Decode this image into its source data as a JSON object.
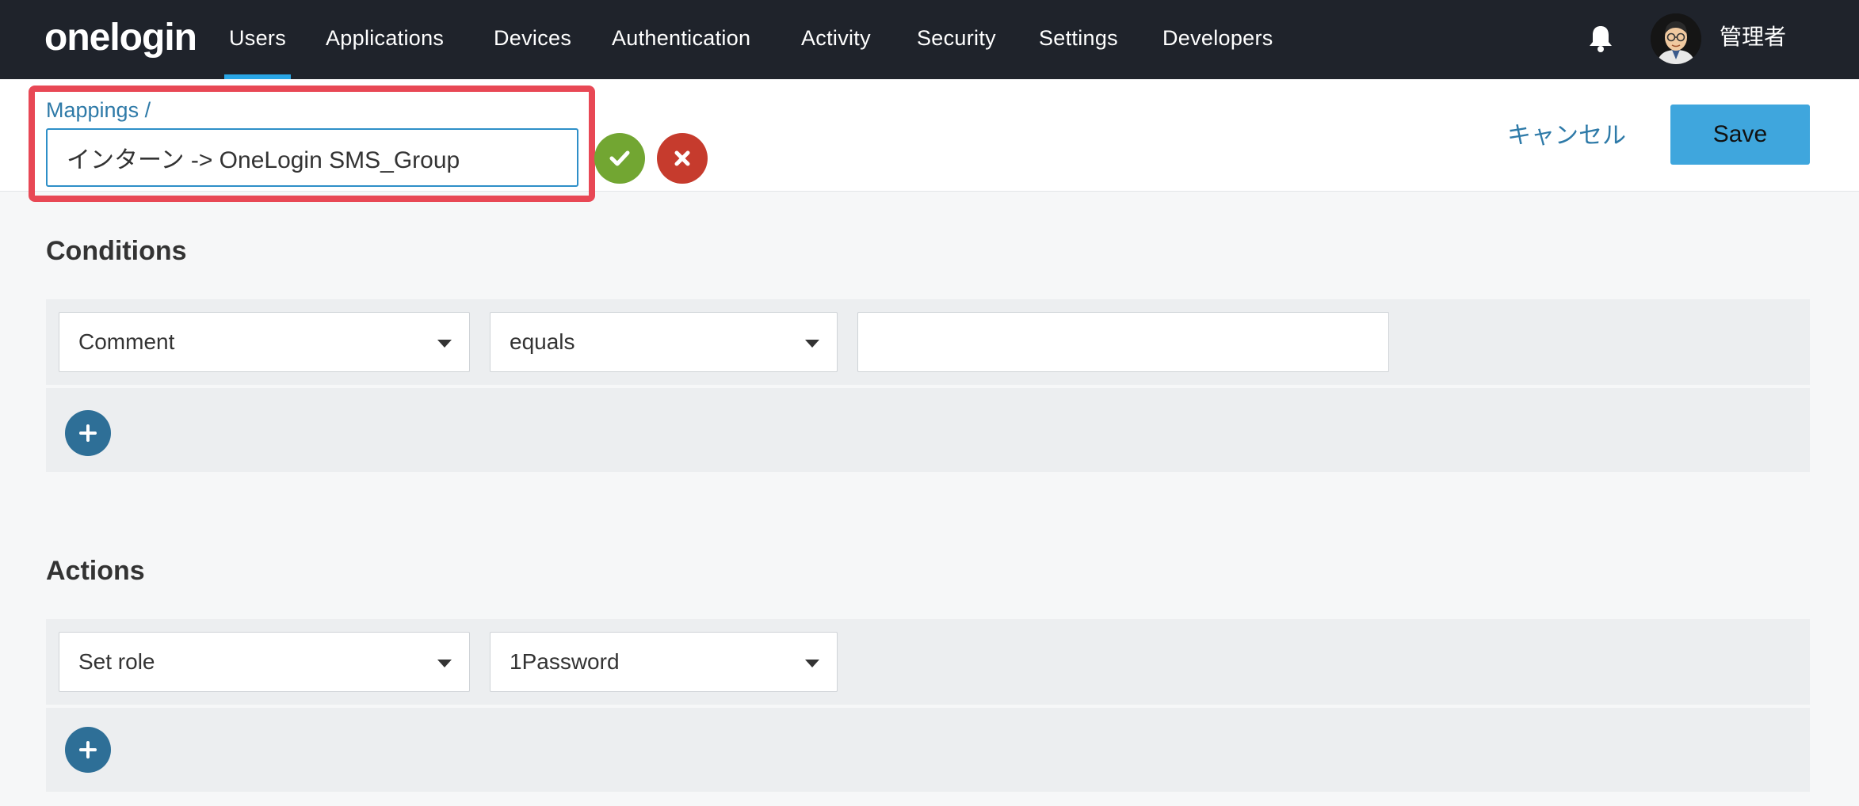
{
  "app": {
    "logo": "onelogin"
  },
  "nav": {
    "items": [
      {
        "label": "Users"
      },
      {
        "label": "Applications"
      },
      {
        "label": "Devices"
      },
      {
        "label": "Authentication"
      },
      {
        "label": "Activity"
      },
      {
        "label": "Security"
      },
      {
        "label": "Settings"
      },
      {
        "label": "Developers"
      }
    ],
    "active": "Users",
    "user_name": "管理者",
    "bell_icon": "bell-icon",
    "avatar_icon": "user-avatar"
  },
  "header": {
    "breadcrumb": "Mappings /",
    "mapping_name": "インターン -> OneLogin SMS_Group",
    "confirm_icon": "check-icon",
    "discard_icon": "x-icon",
    "cancel_label": "キャンセル",
    "save_label": "Save"
  },
  "conditions": {
    "title": "Conditions",
    "rows": [
      {
        "field": "Comment",
        "operator": "equals",
        "value": ""
      }
    ],
    "add_icon": "plus-icon"
  },
  "actions": {
    "title": "Actions",
    "rows": [
      {
        "action": "Set role",
        "value": "1Password"
      }
    ],
    "add_icon": "plus-icon"
  },
  "colors": {
    "nav_bg": "#1f232b",
    "accent": "#29a6e6",
    "highlight": "#e84855",
    "confirm": "#72a632",
    "discard": "#c63b2d",
    "save": "#3fa6dd",
    "add": "#2e6f97"
  }
}
